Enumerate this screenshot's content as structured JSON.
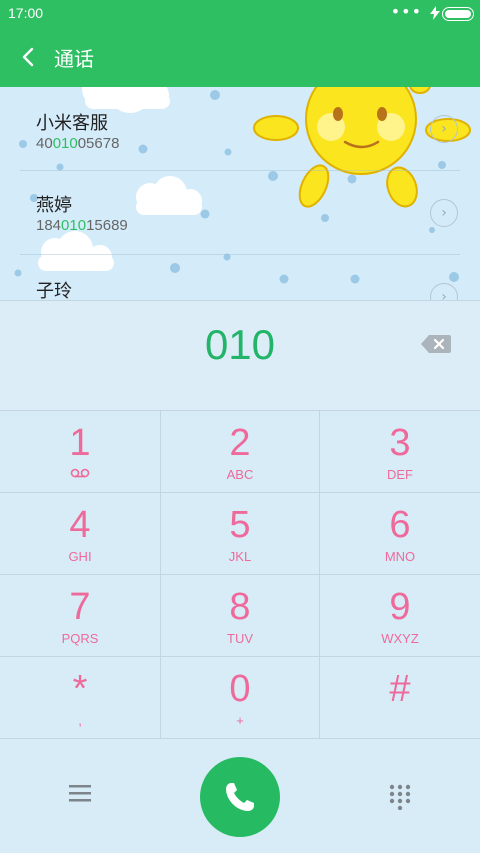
{
  "status_bar": {
    "time": "17:00",
    "dots": "•••",
    "bolt": "⚡"
  },
  "header": {
    "title": "通话"
  },
  "contacts": [
    {
      "name": "小米客服",
      "number_pre": "40",
      "number_hl": "010",
      "number_post": "05678"
    },
    {
      "name": "燕婷",
      "number_pre": "184",
      "number_hl": "010",
      "number_post": "15689"
    },
    {
      "name": "子玲",
      "number_pre": "",
      "number_hl": "",
      "number_post": ""
    }
  ],
  "dial": {
    "number": "010"
  },
  "keypad": [
    {
      "digit": "1",
      "letters": ""
    },
    {
      "digit": "2",
      "letters": "ABC"
    },
    {
      "digit": "3",
      "letters": "DEF"
    },
    {
      "digit": "4",
      "letters": "GHI"
    },
    {
      "digit": "5",
      "letters": "JKL"
    },
    {
      "digit": "6",
      "letters": "MNO"
    },
    {
      "digit": "7",
      "letters": "PQRS"
    },
    {
      "digit": "8",
      "letters": "TUV"
    },
    {
      "digit": "9",
      "letters": "WXYZ"
    },
    {
      "digit": "*",
      "letters": ","
    },
    {
      "digit": "0",
      "letters": "+"
    },
    {
      "digit": "#",
      "letters": ""
    }
  ],
  "icons": {
    "back": "back-icon",
    "backspace": "backspace-icon",
    "voicemail": "voicemail-icon",
    "menu": "menu-icon",
    "phone": "phone-icon",
    "dialpad": "dialpad-icon",
    "detail": "chevron-right-icon"
  },
  "colors": {
    "primary": "#2fbf63",
    "key_text": "#ee6a9b",
    "dial_number": "#22b468",
    "background": "#d8ecf8"
  }
}
